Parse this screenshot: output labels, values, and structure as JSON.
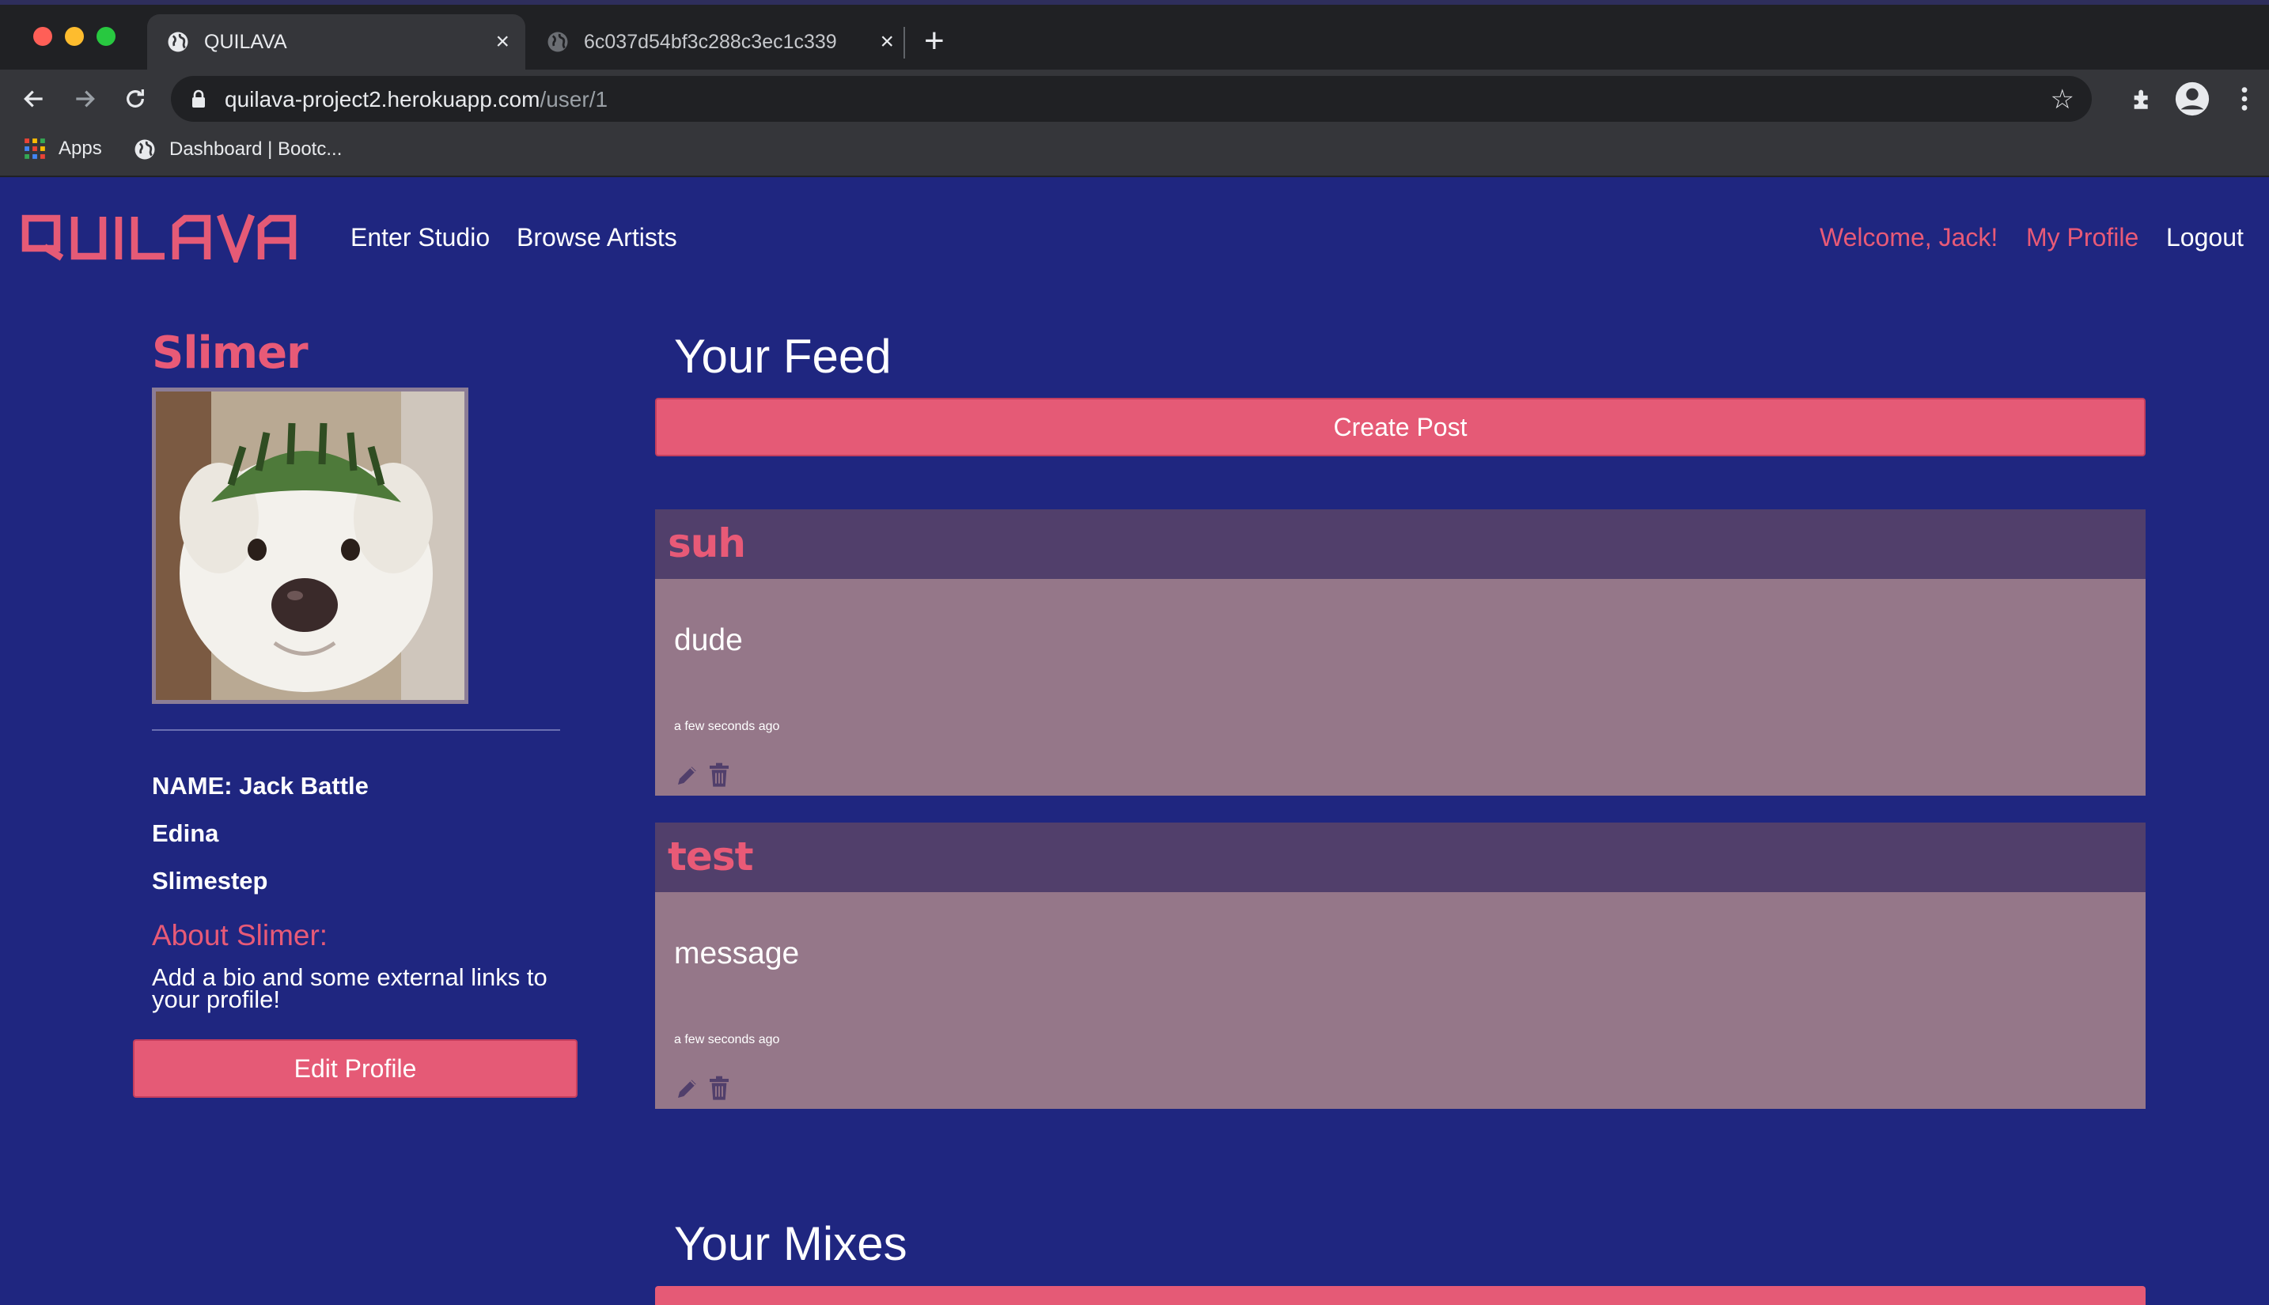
{
  "browser": {
    "tabs": [
      {
        "title": "QUILAVA",
        "active": true
      },
      {
        "title": "6c037d54bf3c288c3ec1c339",
        "active": false
      }
    ],
    "url_host": "quilava-project2.herokuapp.com",
    "url_path": "/user/1",
    "bookmarks": [
      "Apps",
      "Dashboard | Bootc..."
    ]
  },
  "nav": {
    "brand": "QUILAVA",
    "links": [
      "Enter Studio",
      "Browse Artists"
    ],
    "welcome": "Welcome, Jack!",
    "my_profile": "My Profile",
    "logout": "Logout"
  },
  "profile": {
    "display_name": "Slimer",
    "name_line": "NAME: Jack Battle",
    "location": "Edina",
    "genre": "Slimestep",
    "about_title": "About Slimer:",
    "about_body": "Add a bio and some external links to your profile!",
    "edit_label": "Edit Profile"
  },
  "feed": {
    "title": "Your Feed",
    "create_label": "Create Post",
    "posts": [
      {
        "title": "suh",
        "message": "dude",
        "time": "a few seconds ago"
      },
      {
        "title": "test",
        "message": "message",
        "time": "a few seconds ago"
      }
    ]
  },
  "mixes": {
    "title": "Your Mixes"
  },
  "colors": {
    "page_bg": "#1f2680",
    "accent": "#e55a76",
    "post_header": "#513f6b",
    "post_body": "#957789"
  }
}
